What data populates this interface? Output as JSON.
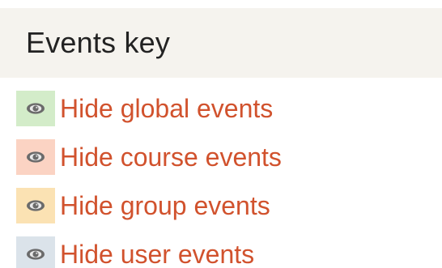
{
  "block": {
    "title": "Events key"
  },
  "colors": {
    "header_bg": "#f5f3ee",
    "link": "#d1522d",
    "icon": "#6b6b6b"
  },
  "events": [
    {
      "label": "Hide global events",
      "icon": "eye-icon",
      "swatch_color": "#d3ecc9"
    },
    {
      "label": "Hide course events",
      "icon": "eye-icon",
      "swatch_color": "#fbd3c3"
    },
    {
      "label": "Hide group events",
      "icon": "eye-icon",
      "swatch_color": "#fbe2b3"
    },
    {
      "label": "Hide user events",
      "icon": "eye-icon",
      "swatch_color": "#dbe3ea"
    }
  ]
}
